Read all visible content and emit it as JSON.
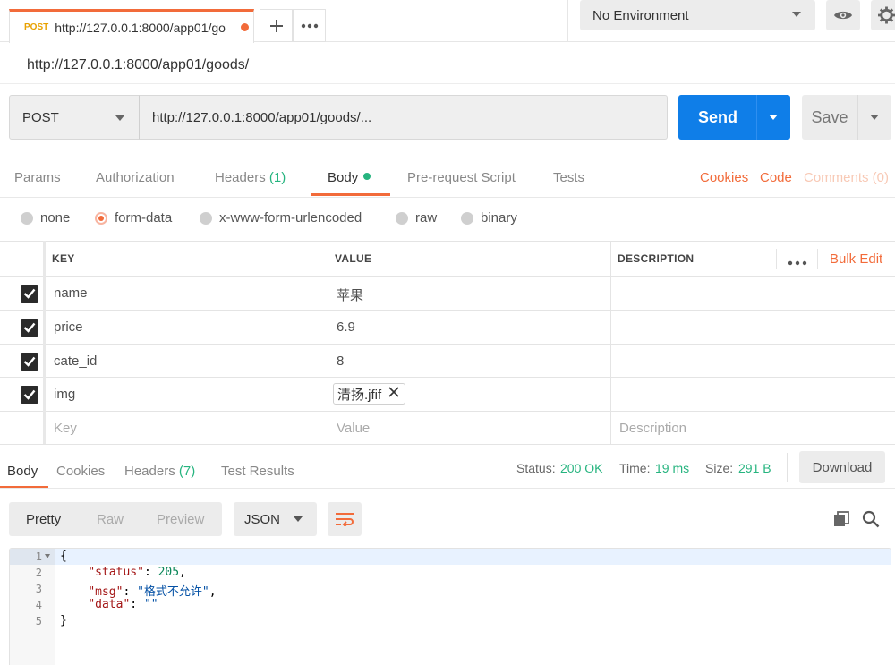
{
  "tab": {
    "method": "POST",
    "title": "http://127.0.0.1:8000/app01/go"
  },
  "environment": "No Environment",
  "request_name": "http://127.0.0.1:8000/app01/goods/",
  "request": {
    "method": "POST",
    "url": "http://127.0.0.1:8000/app01/goods/...",
    "send_label": "Send",
    "save_label": "Save"
  },
  "subtabs": {
    "params": "Params",
    "authorization": "Authorization",
    "headers": "Headers",
    "headers_count": "(1)",
    "body": "Body",
    "prerequest": "Pre-request Script",
    "tests": "Tests",
    "cookies": "Cookies",
    "code": "Code",
    "comments": "Comments (0)"
  },
  "body_modes": [
    "none",
    "form-data",
    "x-www-form-urlencoded",
    "raw",
    "binary"
  ],
  "table": {
    "headers": {
      "key": "KEY",
      "value": "VALUE",
      "description": "DESCRIPTION"
    },
    "bulk_edit": "Bulk Edit",
    "rows": [
      {
        "key": "name",
        "value": "苹果"
      },
      {
        "key": "price",
        "value": "6.9"
      },
      {
        "key": "cate_id",
        "value": "8"
      },
      {
        "key": "img",
        "file": "清扬.jfif"
      }
    ],
    "placeholders": {
      "key": "Key",
      "value": "Value",
      "description": "Description"
    }
  },
  "response": {
    "tabs": {
      "body": "Body",
      "cookies": "Cookies",
      "headers": "Headers",
      "headers_count": "(7)",
      "test_results": "Test Results"
    },
    "status_label": "Status:",
    "status_value": "200 OK",
    "time_label": "Time:",
    "time_value": "19 ms",
    "size_label": "Size:",
    "size_value": "291 B",
    "download": "Download",
    "formats": {
      "pretty": "Pretty",
      "raw": "Raw",
      "preview": "Preview"
    },
    "language": "JSON",
    "code_lines": [
      "1",
      "2",
      "3",
      "4",
      "5"
    ],
    "json": {
      "status_key": "\"status\"",
      "status_val": "205",
      "msg_key": "\"msg\"",
      "msg_val": "\"格式不允许\"",
      "data_key": "\"data\"",
      "data_val": "\"\""
    }
  },
  "colors": {
    "accent": "#f26b3a",
    "send": "#0f7ee8",
    "green": "#26b47f"
  }
}
